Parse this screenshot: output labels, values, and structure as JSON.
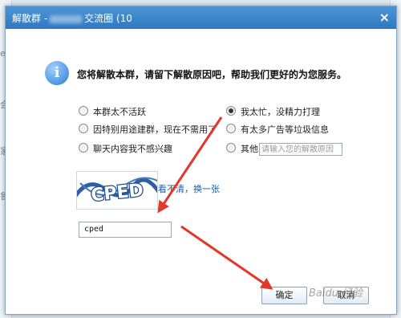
{
  "dialog": {
    "title_prefix": "解散群 -",
    "title_suffix": "交流圈 (10",
    "close_label": "×",
    "info_glyph": "i",
    "headline": "您将解散本群，请留下解散原因吧，帮助我们更好的为您服务。"
  },
  "reasons": {
    "left": [
      "本群太不活跃",
      "因特别用途建群，现在不需用了",
      "聊天内容我不感兴趣"
    ],
    "right": [
      "我太忙，没精力打理",
      "有太多广告等垃圾信息",
      "其他"
    ],
    "selected": "我太忙，没精力打理",
    "other_placeholder": "请输入您的解散原因"
  },
  "captcha": {
    "image_text": "CPED",
    "refresh_label": "看不清，换一张",
    "input_value": "cped"
  },
  "buttons": {
    "ok": "确定",
    "cancel": "取消"
  },
  "colors": {
    "titlebar": "#3a86cc",
    "arrow": "#e2382a",
    "link": "#1a5ea8"
  }
}
